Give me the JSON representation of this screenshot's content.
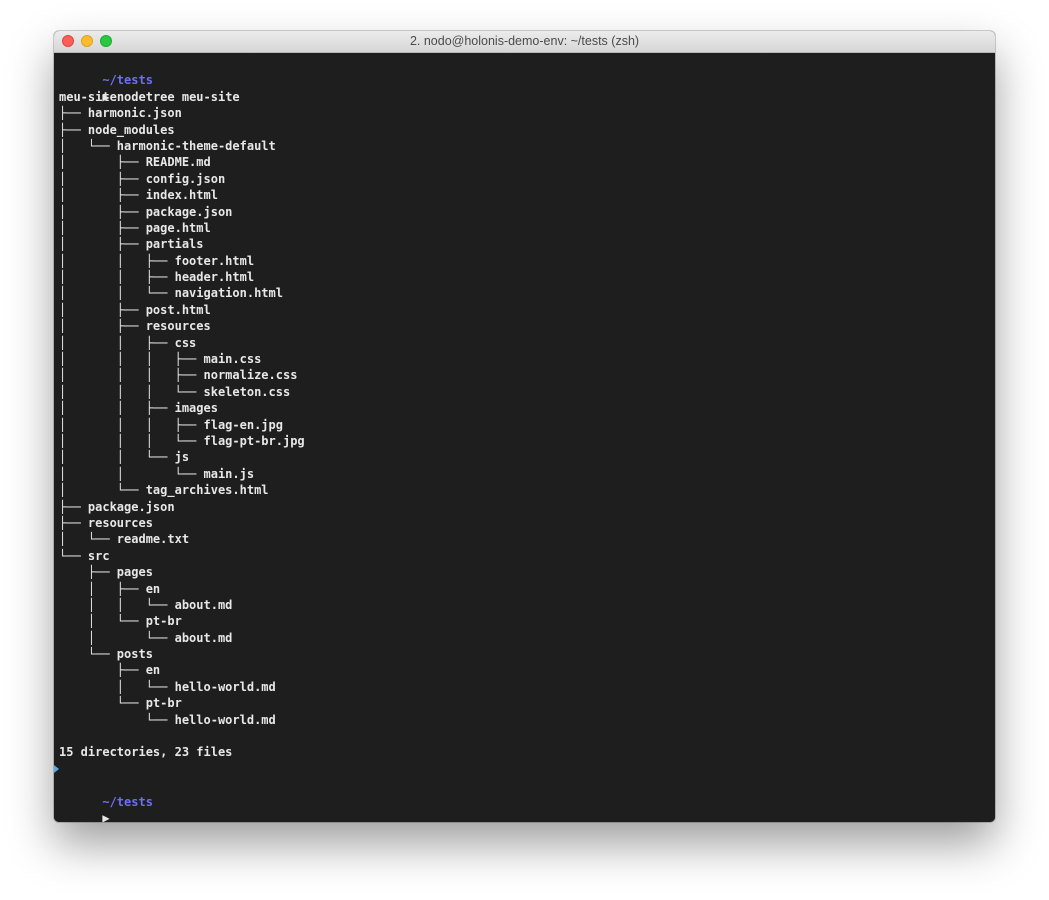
{
  "window": {
    "title": "2. nodo@holonis-demo-env: ~/tests (zsh)"
  },
  "colors": {
    "terminal_bg": "#1e1e1e",
    "text": "#e8e8e8",
    "prompt_directory": "#6d6ff5",
    "prompt_marker": "#5aa9e6"
  },
  "session": {
    "prompt1_dir": "~/tests",
    "prompt_arrow": "▶",
    "command": "nodetree meu-site",
    "tree_lines": [
      "meu-site",
      "├── harmonic.json",
      "├── node_modules",
      "│   └── harmonic-theme-default",
      "│       ├── README.md",
      "│       ├── config.json",
      "│       ├── index.html",
      "│       ├── package.json",
      "│       ├── page.html",
      "│       ├── partials",
      "│       │   ├── footer.html",
      "│       │   ├── header.html",
      "│       │   └── navigation.html",
      "│       ├── post.html",
      "│       ├── resources",
      "│       │   ├── css",
      "│       │   │   ├── main.css",
      "│       │   │   ├── normalize.css",
      "│       │   │   └── skeleton.css",
      "│       │   ├── images",
      "│       │   │   ├── flag-en.jpg",
      "│       │   │   └── flag-pt-br.jpg",
      "│       │   └── js",
      "│       │       └── main.js",
      "│       └── tag_archives.html",
      "├── package.json",
      "├── resources",
      "│   └── readme.txt",
      "└── src",
      "    ├── pages",
      "    │   ├── en",
      "    │   │   └── about.md",
      "    │   └── pt-br",
      "    │       └── about.md",
      "    └── posts",
      "        ├── en",
      "        │   └── hello-world.md",
      "        └── pt-br",
      "            └── hello-world.md"
    ],
    "summary": "15 directories, 23 files",
    "prompt2_dir": "~/tests",
    "prompt2_arrow": "▶"
  }
}
